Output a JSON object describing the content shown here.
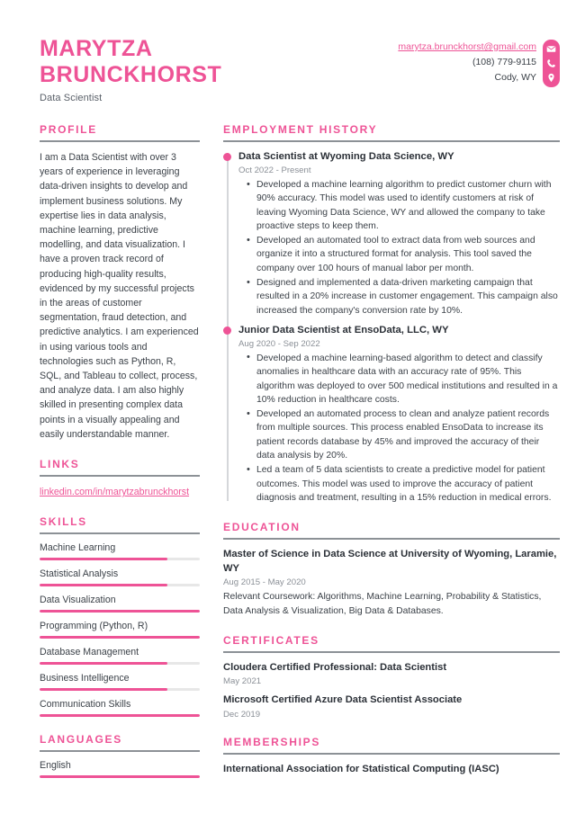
{
  "header": {
    "name": "MARYTZA BRUNCKHORST",
    "job_title": "Data Scientist",
    "contact": {
      "email": "marytza.brunckhorst@gmail.com",
      "phone": "(108) 779-9115",
      "location": "Cody, WY"
    },
    "icons": [
      "envelope-icon",
      "phone-icon",
      "location-pin-icon"
    ]
  },
  "colors": {
    "accent": "#ee5396",
    "rule": "#8c9196",
    "text": "#3b4148",
    "muted": "#8b9097",
    "track": "#e7e7e7"
  },
  "sidebar": {
    "profile": {
      "title": "PROFILE",
      "text": "I am a Data Scientist with over 3 years of experience in leveraging data-driven insights to develop and implement business solutions. My expertise lies in data analysis, machine learning, predictive modelling, and data visualization. I have a proven track record of producing high-quality results, evidenced by my successful projects in the areas of customer segmentation, fraud detection, and predictive analytics. I am experienced in using various tools and technologies such as Python, R, SQL, and Tableau to collect, process, and analyze data. I am also highly skilled in presenting complex data points in a visually appealing and easily understandable manner."
    },
    "links": {
      "title": "LINKS",
      "items": [
        {
          "label": "linkedin.com/in/marytzabrunckhorst"
        }
      ]
    },
    "skills": {
      "title": "SKILLS",
      "items": [
        {
          "label": "Machine Learning",
          "level": 80
        },
        {
          "label": "Statistical Analysis",
          "level": 80
        },
        {
          "label": "Data Visualization",
          "level": 100
        },
        {
          "label": "Programming (Python, R)",
          "level": 100
        },
        {
          "label": "Database Management",
          "level": 80
        },
        {
          "label": "Business Intelligence",
          "level": 80
        },
        {
          "label": "Communication Skills",
          "level": 100
        }
      ]
    },
    "languages": {
      "title": "LANGUAGES",
      "items": [
        {
          "label": "English",
          "level": 100
        }
      ]
    }
  },
  "main": {
    "employment": {
      "title": "EMPLOYMENT HISTORY",
      "jobs": [
        {
          "heading": "Data Scientist at Wyoming Data Science, WY",
          "date": "Oct 2022 - Present",
          "points": [
            "Developed a machine learning algorithm to predict customer churn with 90% accuracy. This model was used to identify customers at risk of leaving Wyoming Data Science, WY and allowed the company to take proactive steps to keep them.",
            "Developed an automated tool to extract data from web sources and organize it into a structured format for analysis. This tool saved the company over 100 hours of manual labor per month.",
            "Designed and implemented a data-driven marketing campaign that resulted in a 20% increase in customer engagement. This campaign also increased the company's conversion rate by 10%."
          ]
        },
        {
          "heading": "Junior Data Scientist at EnsoData, LLC, WY",
          "date": "Aug 2020 - Sep 2022",
          "points": [
            "Developed a machine learning-based algorithm to detect and classify anomalies in healthcare data with an accuracy rate of 95%. This algorithm was deployed to over 500 medical institutions and resulted in a 10% reduction in healthcare costs.",
            "Developed an automated process to clean and analyze patient records from multiple sources. This process enabled EnsoData to increase its patient records database by 45% and improved the accuracy of their data analysis by 20%.",
            "Led a team of 5 data scientists to create a predictive model for patient outcomes. This model was used to improve the accuracy of patient diagnosis and treatment, resulting in a 15% reduction in medical errors."
          ]
        }
      ]
    },
    "education": {
      "title": "EDUCATION",
      "items": [
        {
          "title": "Master of Science in Data Science at University of Wyoming, Laramie, WY",
          "date": "Aug 2015 - May 2020",
          "desc": "Relevant Coursework: Algorithms, Machine Learning, Probability & Statistics, Data Analysis & Visualization, Big Data & Databases."
        }
      ]
    },
    "certificates": {
      "title": "CERTIFICATES",
      "items": [
        {
          "title": "Cloudera Certified Professional: Data Scientist",
          "date": "May 2021"
        },
        {
          "title": "Microsoft Certified Azure Data Scientist Associate",
          "date": "Dec 2019"
        }
      ]
    },
    "memberships": {
      "title": "MEMBERSHIPS",
      "items": [
        {
          "title": "International Association for Statistical Computing (IASC)"
        }
      ]
    }
  }
}
